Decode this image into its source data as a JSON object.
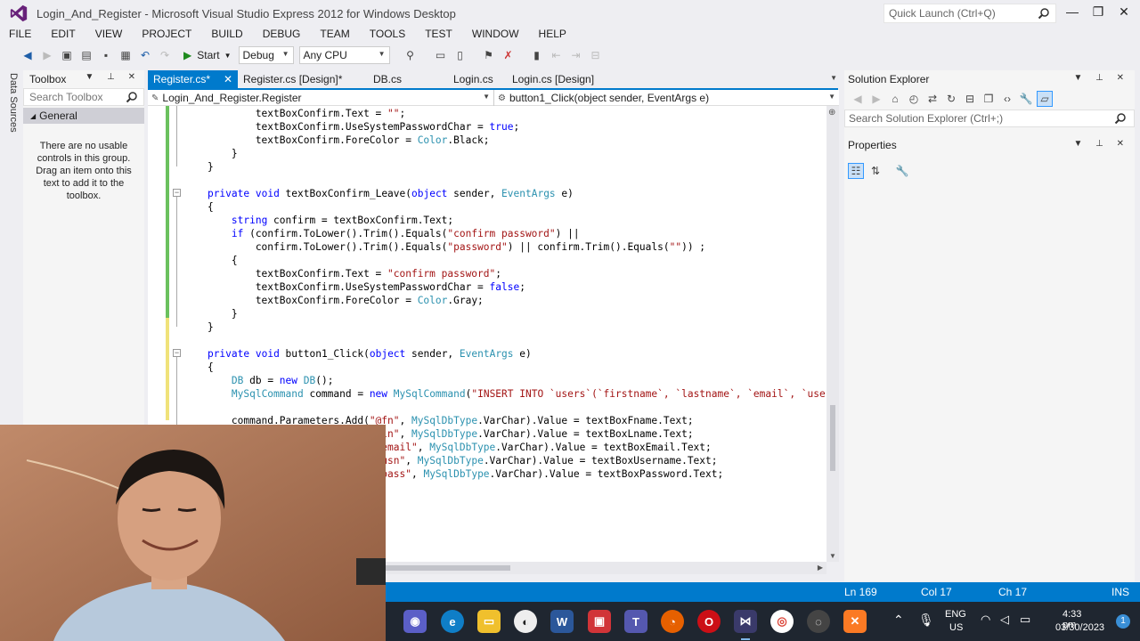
{
  "window": {
    "title": "Login_And_Register - Microsoft Visual Studio Express 2012 for Windows Desktop",
    "quick_launch_placeholder": "Quick Launch (Ctrl+Q)",
    "min_glyph": "—",
    "max_glyph": "❐",
    "close_glyph": "✕"
  },
  "menu": [
    "FILE",
    "EDIT",
    "VIEW",
    "PROJECT",
    "BUILD",
    "DEBUG",
    "TEAM",
    "TOOLS",
    "TEST",
    "WINDOW",
    "HELP"
  ],
  "toolbar": {
    "start_label": "Start",
    "config": "Debug",
    "platform": "Any CPU"
  },
  "left_strip": {
    "data_sources": "Data Sources"
  },
  "toolbox": {
    "title": "Toolbox",
    "search_placeholder": "Search Toolbox",
    "group": "General",
    "empty_message": "There are no usable controls in this group. Drag an item onto this text to add it to the toolbox."
  },
  "tabs": [
    {
      "label": "Register.cs*",
      "active": true
    },
    {
      "label": "Register.cs [Design]*",
      "active": false
    },
    {
      "label": "DB.cs",
      "active": false
    },
    {
      "label": "Login.cs",
      "active": false
    },
    {
      "label": "Login.cs [Design]",
      "active": false
    }
  ],
  "navbar": {
    "class_combo": "Login_And_Register.Register",
    "member_combo": "button1_Click(object sender, EventArgs e)"
  },
  "code": [
    "            textBoxConfirm.Text = \"\";",
    "            textBoxConfirm.UseSystemPasswordChar = true;",
    "            textBoxConfirm.ForeColor = Color.Black;",
    "        }",
    "    }",
    "",
    "    private void textBoxConfirm_Leave(object sender, EventArgs e)",
    "    {",
    "        string confirm = textBoxConfirm.Text;",
    "        if (confirm.ToLower().Trim().Equals(\"confirm password\") ||",
    "            confirm.ToLower().Trim().Equals(\"password\") || confirm.Trim().Equals(\"\")) ;",
    "        {",
    "            textBoxConfirm.Text = \"confirm password\";",
    "            textBoxConfirm.UseSystemPasswordChar = false;",
    "            textBoxConfirm.ForeColor = Color.Gray;",
    "        }",
    "    }",
    "",
    "    private void button1_Click(object sender, EventArgs e)",
    "    {",
    "        DB db = new DB();",
    "        MySqlCommand command = new MySqlCommand(\"INSERT INTO `users`(`firstname`, `lastname`, `email`, `use",
    "",
    "        command.Parameters.Add(\"@fn\", MySqlDbType.VarChar).Value = textBoxFname.Text;",
    "        command.Parameters.Add(\"@ln\", MySqlDbType.VarChar).Value = textBoxLname.Text;",
    "        command.Parameters.Add(\"@email\", MySqlDbType.VarChar).Value = textBoxEmail.Text;",
    "        command.Parameters.Add(\"@usn\", MySqlDbType.VarChar).Value = textBoxUsername.Text;",
    "        command.Parameters.Add(\"@pass\", MySqlDbType.VarChar).Value = textBoxPassword.Text;",
    "",
    "",
    "",
    ""
  ],
  "solution_explorer": {
    "title": "Solution Explorer",
    "search_placeholder": "Search Solution Explorer (Ctrl+;)"
  },
  "properties": {
    "title": "Properties"
  },
  "status": {
    "ln": "Ln 169",
    "col": "Col 17",
    "ch": "Ch 17",
    "mode": "INS"
  },
  "tray": {
    "lang": "ENG",
    "region": "US",
    "time": "4:33 pm",
    "date": "03/30/2023",
    "notifications": "1"
  },
  "colors": {
    "accent": "#007acc",
    "keyword": "#0000ff",
    "type": "#2b91af",
    "string": "#a31515"
  }
}
